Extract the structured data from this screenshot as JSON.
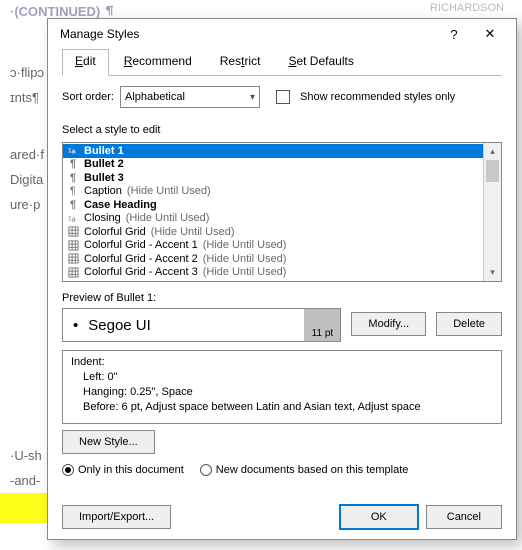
{
  "doc": {
    "header_left": "·(CONTINUED)",
    "header_right": "RICHARDSON",
    "lines": [
      "ɔ·flipɔ",
      "ɪnts¶",
      "ared·f",
      "Digita",
      "ure·p",
      "·U-sh",
      "-and-"
    ]
  },
  "dialog": {
    "title": "Manage Styles",
    "help": "?",
    "close": "✕",
    "tabs": {
      "edit": "Edit",
      "recommend": "Recommend",
      "restrict": "Restrict",
      "set_defaults": "Set Defaults"
    },
    "sort_label": "Sort order:",
    "sort_value": "Alphabetical",
    "show_rec": "Show recommended styles only",
    "select_label": "Select a style to edit",
    "styles": [
      {
        "name": "Bullet 1",
        "bold": true,
        "selected": true,
        "icon": "a-list"
      },
      {
        "name": "Bullet 2",
        "bold": true,
        "icon": "para"
      },
      {
        "name": "Bullet 3",
        "bold": true,
        "icon": "para"
      },
      {
        "name": "Caption",
        "hint": "(Hide Until Used)",
        "icon": "para"
      },
      {
        "name": "Case Heading",
        "bold": true,
        "icon": "para"
      },
      {
        "name": "Closing",
        "hint": "(Hide Until Used)",
        "icon": "a-list"
      },
      {
        "name": "Colorful Grid",
        "hint": "(Hide Until Used)",
        "icon": "grid"
      },
      {
        "name": "Colorful Grid - Accent 1",
        "hint": "(Hide Until Used)",
        "icon": "grid"
      },
      {
        "name": "Colorful Grid - Accent 2",
        "hint": "(Hide Until Used)",
        "icon": "grid"
      },
      {
        "name": "Colorful Grid - Accent 3",
        "hint": "(Hide Until Used)",
        "icon": "grid"
      }
    ],
    "preview_label": "Preview of Bullet 1:",
    "preview_text": "Segoe UI",
    "preview_pt": "11 pt",
    "modify": "Modify...",
    "delete": "Delete",
    "indent": {
      "h": "Indent:",
      "l1": "Left:  0\"",
      "l2": "Hanging:  0.25\", Space",
      "l3": "Before:  6 pt, Adjust space between Latin and Asian text, Adjust space"
    },
    "new_style": "New Style...",
    "only_doc": "Only in this document",
    "new_docs": "New documents based on this template",
    "import_export": "Import/Export...",
    "ok": "OK",
    "cancel": "Cancel"
  }
}
